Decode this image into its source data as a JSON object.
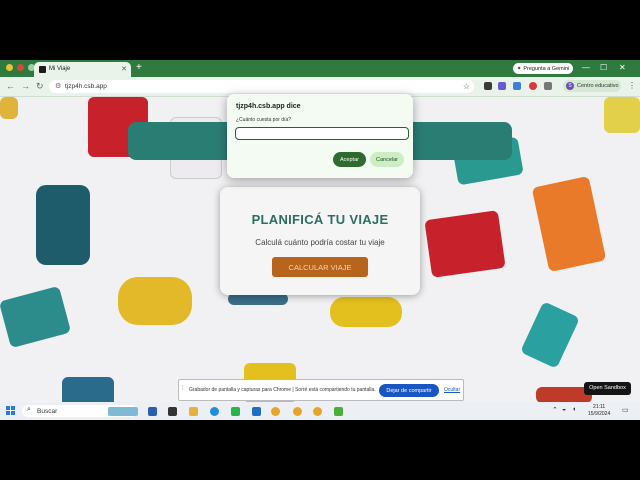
{
  "browser": {
    "tab_title": "Mi Viaje",
    "new_tab": "+",
    "gemini_label": "Pregunta a Gemini",
    "url": "tjzp4h.csb.app",
    "profile_label": "Centro educativo",
    "profile_initial": "S"
  },
  "page": {
    "heading": "PLANIFICÁ TU VIAJE",
    "subtitle": "Calculá cuánto podría costar tu viaje",
    "calc_button": "CALCULAR VIAJE"
  },
  "dialog": {
    "title": "tjzp4h.csb.app dice",
    "message": "¿Cuánto cuesta por día?",
    "input_value": "",
    "ok_label": "Aceptar",
    "cancel_label": "Cancelar"
  },
  "share_banner": {
    "text": "Grabador de pantalla y capturas para Chrome | Sorré está compartiendo tu pantalla.",
    "stop_label": "Dejar de compartir",
    "hide_label": "Ocultar"
  },
  "sandbox_label": "Open Sandbox",
  "taskbar": {
    "search_label": "Buscar",
    "time": "21:11",
    "date": "15/9/2024"
  },
  "colors": {
    "chrome_green": "#2f7a3e",
    "teal": "#2a7d73",
    "calc_button": "#b7651c",
    "dialog_ok": "#2f6b2f",
    "dialog_cancel": "#cdeec3",
    "share_blue": "#1a55c4"
  }
}
